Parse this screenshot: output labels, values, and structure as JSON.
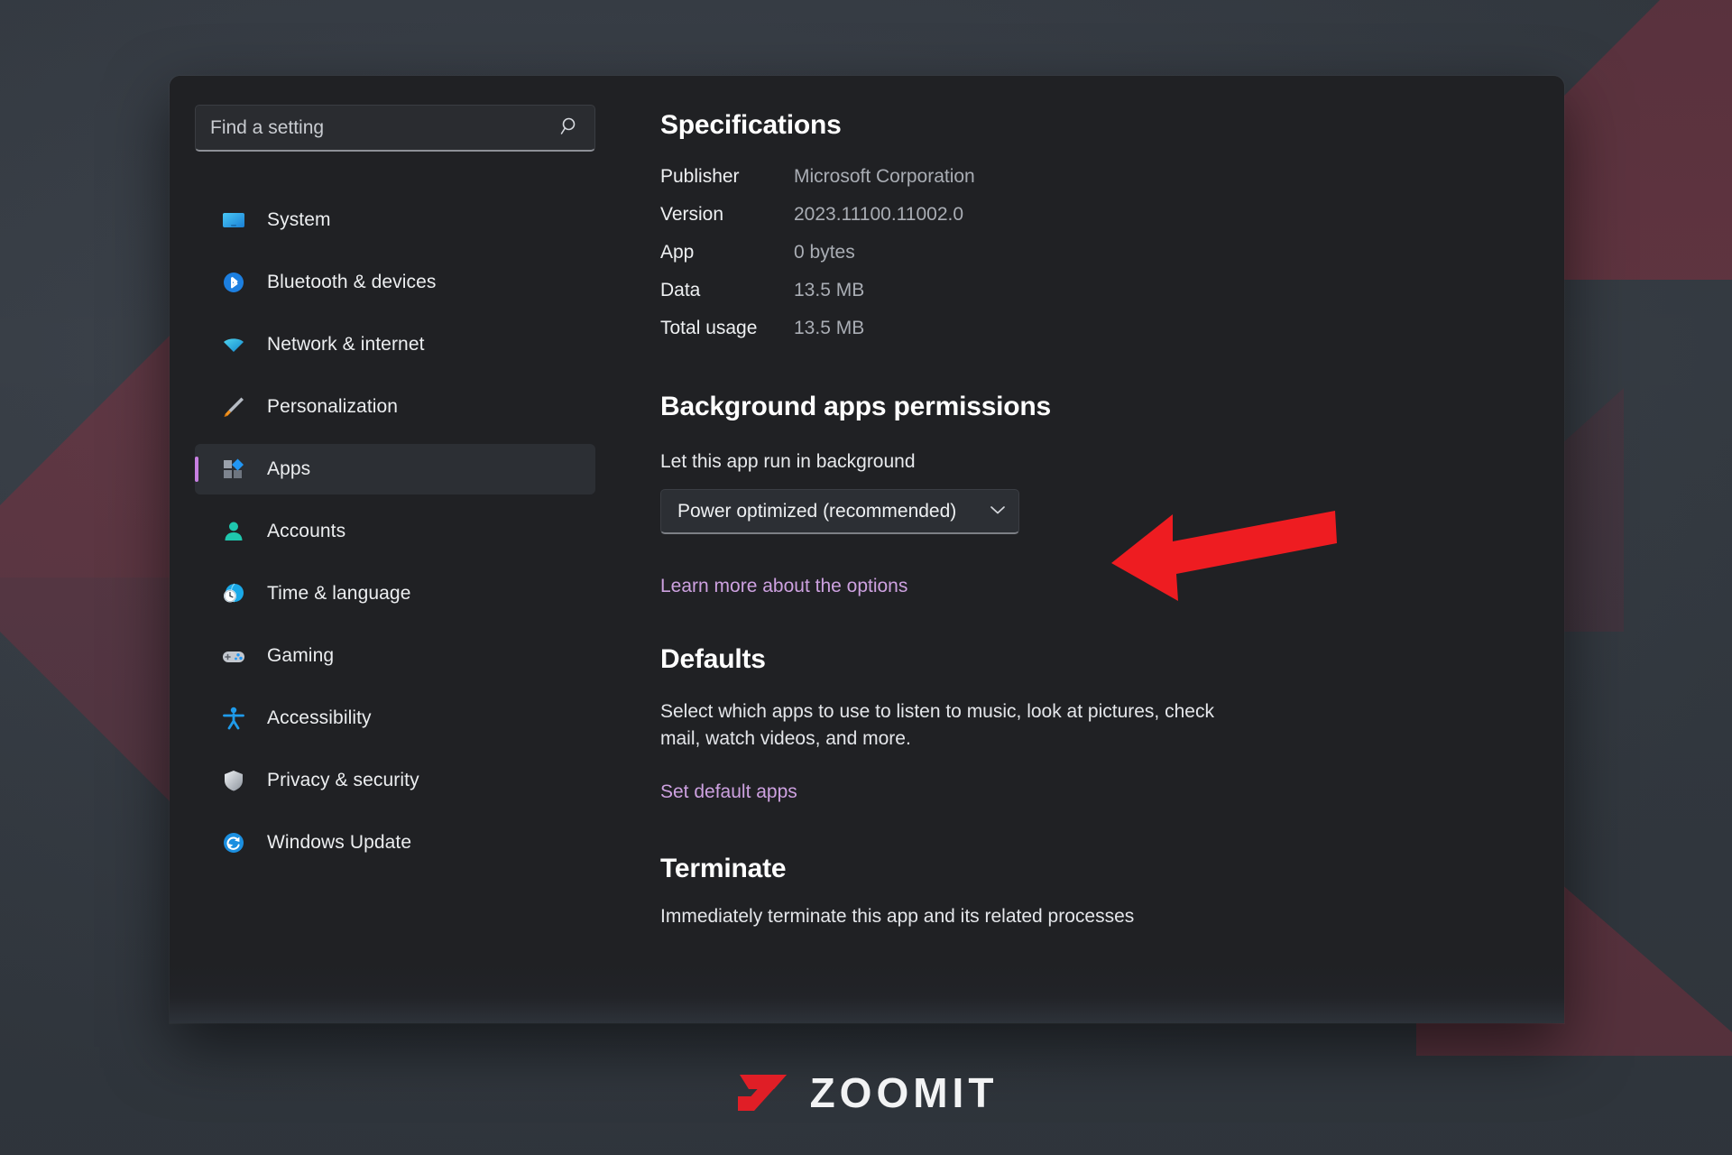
{
  "search": {
    "placeholder": "Find a setting",
    "value": "",
    "icon": "search-icon"
  },
  "sidebar": {
    "items": [
      {
        "label": "System",
        "icon": "monitor-icon",
        "selected": false
      },
      {
        "label": "Bluetooth & devices",
        "icon": "bluetooth-icon",
        "selected": false
      },
      {
        "label": "Network & internet",
        "icon": "wifi-icon",
        "selected": false
      },
      {
        "label": "Personalization",
        "icon": "paintbrush-icon",
        "selected": false
      },
      {
        "label": "Apps",
        "icon": "apps-blocks-icon",
        "selected": true
      },
      {
        "label": "Accounts",
        "icon": "person-icon",
        "selected": false
      },
      {
        "label": "Time & language",
        "icon": "clock-globe-icon",
        "selected": false
      },
      {
        "label": "Gaming",
        "icon": "gamepad-icon",
        "selected": false
      },
      {
        "label": "Accessibility",
        "icon": "accessibility-icon",
        "selected": false
      },
      {
        "label": "Privacy & security",
        "icon": "shield-icon",
        "selected": false
      },
      {
        "label": "Windows Update",
        "icon": "refresh-circle-icon",
        "selected": false
      }
    ],
    "selected_accent": "#c77fe0"
  },
  "specifications": {
    "title": "Specifications",
    "rows": [
      {
        "key": "Publisher",
        "value": "Microsoft Corporation"
      },
      {
        "key": "Version",
        "value": "2023.11100.11002.0"
      },
      {
        "key": "App",
        "value": "0 bytes"
      },
      {
        "key": "Data",
        "value": "13.5 MB"
      },
      {
        "key": "Total usage",
        "value": "13.5 MB"
      }
    ]
  },
  "background_permissions": {
    "title": "Background apps permissions",
    "subtitle": "Let this app run in background",
    "dropdown_value": "Power optimized (recommended)",
    "dropdown_chevron": "chevron-down-icon",
    "learn_more_link": "Learn more about the options"
  },
  "defaults": {
    "title": "Defaults",
    "description": "Select which apps to use to listen to music, look at pictures, check mail, watch videos, and more.",
    "link": "Set default apps"
  },
  "terminate": {
    "title": "Terminate",
    "description": "Immediately terminate this app and its related processes"
  },
  "annotation": {
    "arrow": "left-pointing-red-arrow",
    "color": "#ee1c21"
  },
  "watermark": {
    "text": "ZOOMIT",
    "mark": "zoomit-z-logo",
    "mark_color": "#e01e26"
  }
}
